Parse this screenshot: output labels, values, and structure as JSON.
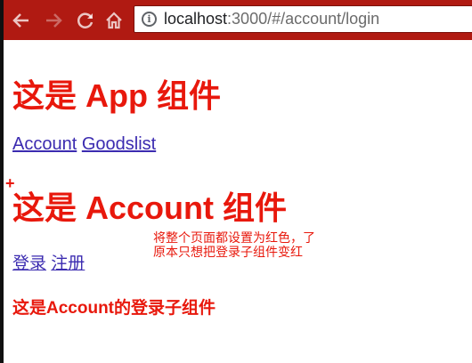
{
  "browser": {
    "url_host": "localhost",
    "url_rest": ":3000/#/account/login",
    "info_glyph": "i",
    "toolbar_color": "#b01a12",
    "icons": [
      "back-arrow-icon",
      "forward-arrow-icon",
      "reload-icon",
      "home-icon",
      "info-icon"
    ]
  },
  "page": {
    "text_color": "#e8180c",
    "link_color": "#3b2bb0",
    "app_title": "这是 App 组件",
    "nav": {
      "account_link": "Account",
      "goodslist_link": "Goodslist"
    },
    "plus_mark": "+",
    "account_title": "这是 Account 组件",
    "annotation": {
      "line1": "将整个页面都设置为红色，了",
      "line2": "原本只想把登录子组件变红"
    },
    "sub_nav": {
      "login_link": "登录",
      "register_link": "注册"
    },
    "login_heading": "这是Account的登录子组件"
  }
}
